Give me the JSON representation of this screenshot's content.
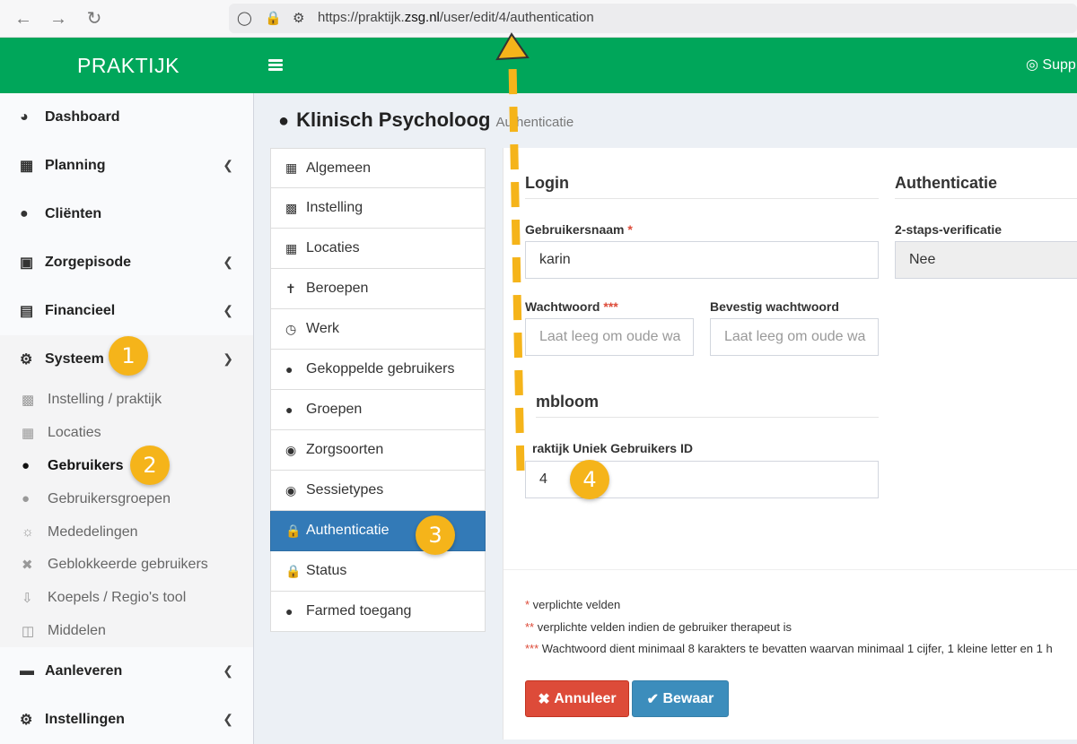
{
  "browser": {
    "url_prefix": "https://praktijk.",
    "url_host": "zsg.nl",
    "url_path": "/user/edit/4/authentication"
  },
  "header": {
    "brand": "PRAKTIJK",
    "support_label": "Supp"
  },
  "sidebar": {
    "items": [
      {
        "label": "Dashboard",
        "icon": "dashboard-icon"
      },
      {
        "label": "Planning",
        "icon": "calendar-icon"
      },
      {
        "label": "Cliënten",
        "icon": "user-icon"
      },
      {
        "label": "Zorgepisode",
        "icon": "medkit-icon"
      },
      {
        "label": "Financieel",
        "icon": "book-icon"
      },
      {
        "label": "Systeem",
        "icon": "cogs-icon"
      }
    ],
    "sub_items": [
      {
        "label": "Instelling / praktijk",
        "icon": "building-icon"
      },
      {
        "label": "Locaties",
        "icon": "map-icon"
      },
      {
        "label": "Gebruikers",
        "icon": "user-icon"
      },
      {
        "label": "Gebruikersgroepen",
        "icon": "users-icon"
      },
      {
        "label": "Mededelingen",
        "icon": "comments-icon"
      },
      {
        "label": "Geblokkeerde gebruikers",
        "icon": "user-times-icon"
      },
      {
        "label": "Koepels / Regio's tool",
        "icon": "download-icon"
      },
      {
        "label": "Middelen",
        "icon": "cubes-icon"
      }
    ],
    "bottom_items": [
      {
        "label": "Aanleveren",
        "icon": "truck-icon"
      },
      {
        "label": "Instellingen",
        "icon": "cog-icon"
      }
    ]
  },
  "page": {
    "title": "Klinisch Psycholoog",
    "subtitle": "Authenticatie"
  },
  "tabs": [
    {
      "label": "Algemeen",
      "icon": "table-icon"
    },
    {
      "label": "Instelling",
      "icon": "building-icon"
    },
    {
      "label": "Locaties",
      "icon": "map-icon"
    },
    {
      "label": "Beroepen",
      "icon": "child-icon"
    },
    {
      "label": "Werk",
      "icon": "clock-icon"
    },
    {
      "label": "Gekoppelde gebruikers",
      "icon": "user-icon"
    },
    {
      "label": "Groepen",
      "icon": "users-icon"
    },
    {
      "label": "Zorgsoorten",
      "icon": "globe-icon"
    },
    {
      "label": "Sessietypes",
      "icon": "globe-icon"
    },
    {
      "label": "Authenticatie",
      "icon": "lock-icon"
    },
    {
      "label": "Status",
      "icon": "lock-icon"
    },
    {
      "label": "Farmed toegang",
      "icon": "user-md-icon"
    }
  ],
  "form": {
    "login_heading": "Login",
    "auth_heading": "Authenticatie",
    "username_label": "Gebruikersnaam",
    "username_req": "*",
    "username_value": "karin",
    "twofa_label": "2-staps-verificatie",
    "twofa_value": "Nee",
    "password_label": "Wachtwoord",
    "password_req": "***",
    "password_placeholder": "Laat leeg om oude wa",
    "confirm_label": "Bevestig wachtwoord",
    "confirm_placeholder": "Laat leeg om oude wa",
    "embleem_heading": "mbloom",
    "uid_label": "raktijk Uniek Gebruikers ID",
    "uid_value": "4"
  },
  "notes": [
    {
      "mark": "*",
      "text": " verplichte velden"
    },
    {
      "mark": "**",
      "text": " verplichte velden indien de gebruiker therapeut is"
    },
    {
      "mark": "***",
      "text": " Wachtwoord dient minimaal 8 karakters te bevatten waarvan minimaal 1 cijfer, 1 kleine letter en 1 h"
    }
  ],
  "buttons": {
    "cancel": "Annuleer",
    "save": "Bewaar"
  },
  "annotations": [
    "1",
    "2",
    "3",
    "4"
  ],
  "colors": {
    "header_green": "#00a65a",
    "active_tab_blue": "#337ab7",
    "danger_red": "#dd4b39",
    "save_blue": "#3c8dbc",
    "badge_yellow": "#f5b41a"
  }
}
